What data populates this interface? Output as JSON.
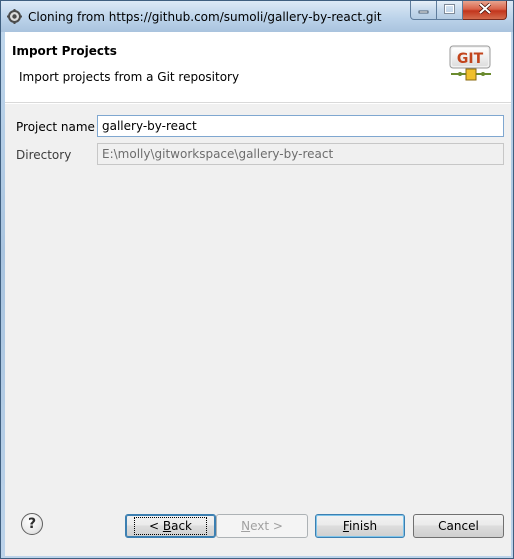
{
  "window": {
    "title": "Cloning from https://github.com/sumoli/gallery-by-react.git"
  },
  "header": {
    "title": "Import Projects",
    "description": "Import projects from a Git repository",
    "logo_text": "GIT"
  },
  "form": {
    "project_name_label": "Project name",
    "project_name_value": "gallery-by-react",
    "directory_label": "Directory",
    "directory_value": "E:\\molly\\gitworkspace\\gallery-by-react"
  },
  "buttons": {
    "help_glyph": "?",
    "back_prefix": "< ",
    "back_mnemonic": "B",
    "back_rest": "ack",
    "next_mnemonic": "N",
    "next_rest": "ext >",
    "finish_mnemonic": "F",
    "finish_rest": "inish",
    "cancel_label": "Cancel"
  },
  "icons": {
    "app": "eclipse-gear-icon",
    "minimize": "minimize-icon",
    "maximize": "maximize-icon",
    "close": "close-icon",
    "help": "help-icon"
  },
  "colors": {
    "titlebar": "#bcd3ea",
    "close_button": "#c2351d",
    "dialog_background": "#f0f0f0",
    "focus_border": "#3c7fb1"
  }
}
